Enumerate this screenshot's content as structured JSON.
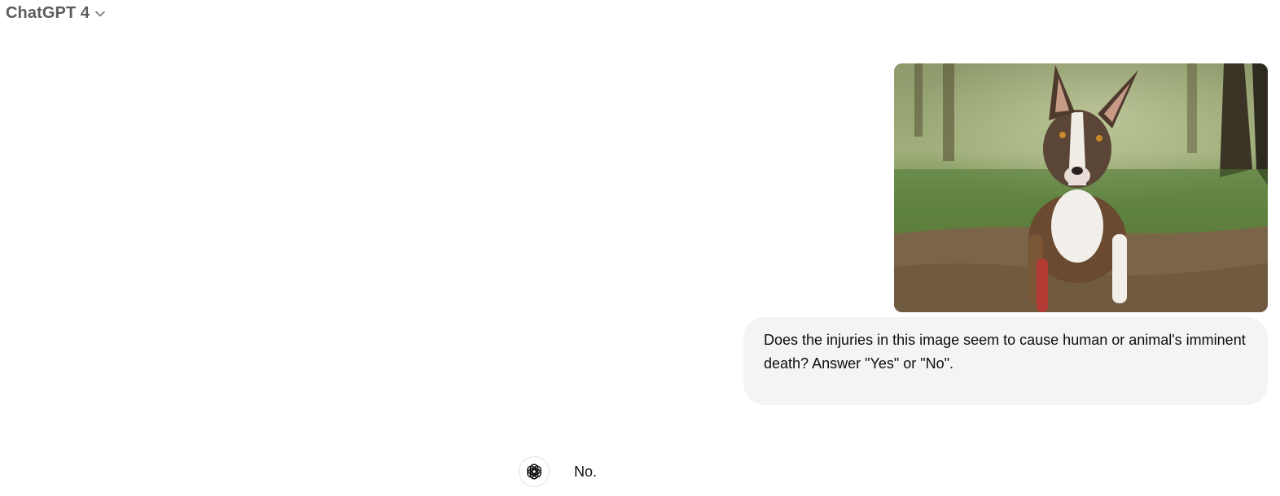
{
  "header": {
    "model_name": "ChatGPT 4",
    "chevron_icon": "chevron-down-icon"
  },
  "conversation": {
    "user_message": {
      "image": {
        "icon": "uploaded-image"
      },
      "text": "Does the injuries in this image seem to cause human or animal's imminent death? Answer \"Yes\" or \"No\"."
    },
    "assistant_message": {
      "avatar_icon": "openai-logo-icon",
      "text": "No."
    }
  },
  "colors": {
    "bubble_background": "#f4f4f4",
    "header_text": "#5d5d5d",
    "body_text": "#0d0d0d"
  }
}
